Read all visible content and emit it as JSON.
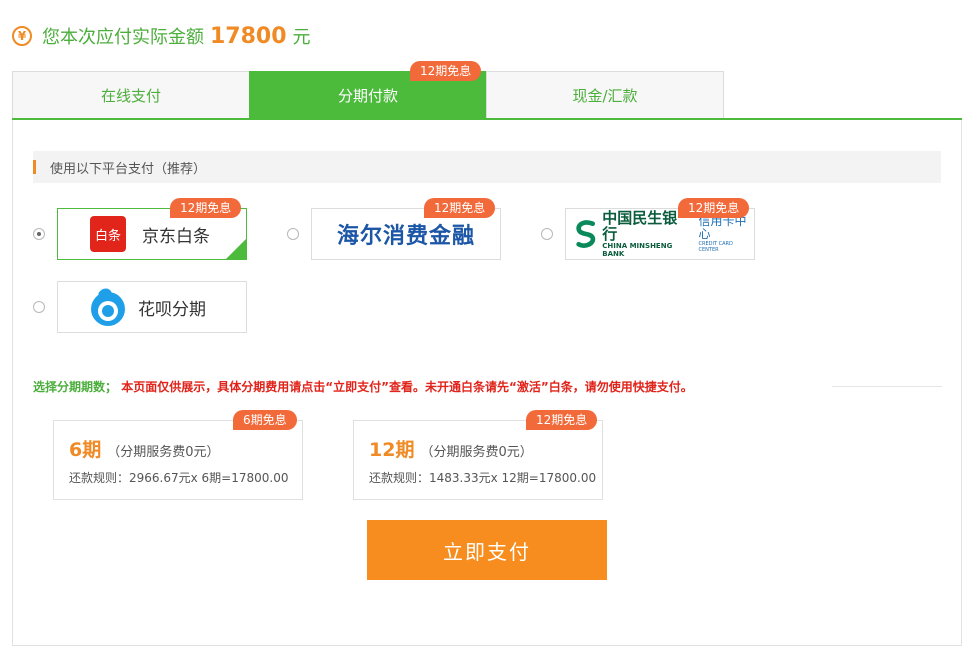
{
  "header": {
    "yen_symbol": "¥",
    "label": "您本次应付实际金额",
    "amount": "17800",
    "unit": "元"
  },
  "tabs": [
    {
      "label": "在线支付",
      "active": false
    },
    {
      "label": "分期付款",
      "active": true,
      "badge": "12期免息"
    },
    {
      "label": "现金/汇款",
      "active": false
    }
  ],
  "platforms": {
    "heading": "使用以下平台支付（推荐）",
    "items": [
      {
        "name": "京东白条",
        "logo_text": "白条",
        "badge": "12期免息",
        "selected": true
      },
      {
        "name": "海尔消费金融",
        "logo_text": "海尔消费金融",
        "badge": "12期免息",
        "selected": false
      },
      {
        "name": "中国民生银行",
        "logo_en": "CHINA MINSHENG BANK",
        "logo_sub": "信用卡中心",
        "logo_sub_en": "CREDIT CARD CENTER",
        "badge": "12期免息",
        "selected": false
      },
      {
        "name": "花呗分期",
        "selected": false
      }
    ]
  },
  "notice": {
    "prefix": "选择分期期数；",
    "text": "本页面仅供展示，具体分期费用请点击“立即支付”查看。未开通白条请先“激活”白条，请勿使用快捷支付。"
  },
  "plans": [
    {
      "badge": "6期免息",
      "period": "6期",
      "fee": "（分期服务费0元）",
      "rule": "还款规则：2966.67元x 6期=17800.00"
    },
    {
      "badge": "12期免息",
      "period": "12期",
      "fee": "（分期服务费0元）",
      "rule": "还款规则：1483.33元x 12期=17800.00"
    }
  ],
  "pay_button": "立即支付",
  "colors": {
    "green": "#4cbb3c",
    "orange": "#f08a24",
    "badge": "#f2693a",
    "red": "#e0241b",
    "button": "#f78d1e"
  }
}
